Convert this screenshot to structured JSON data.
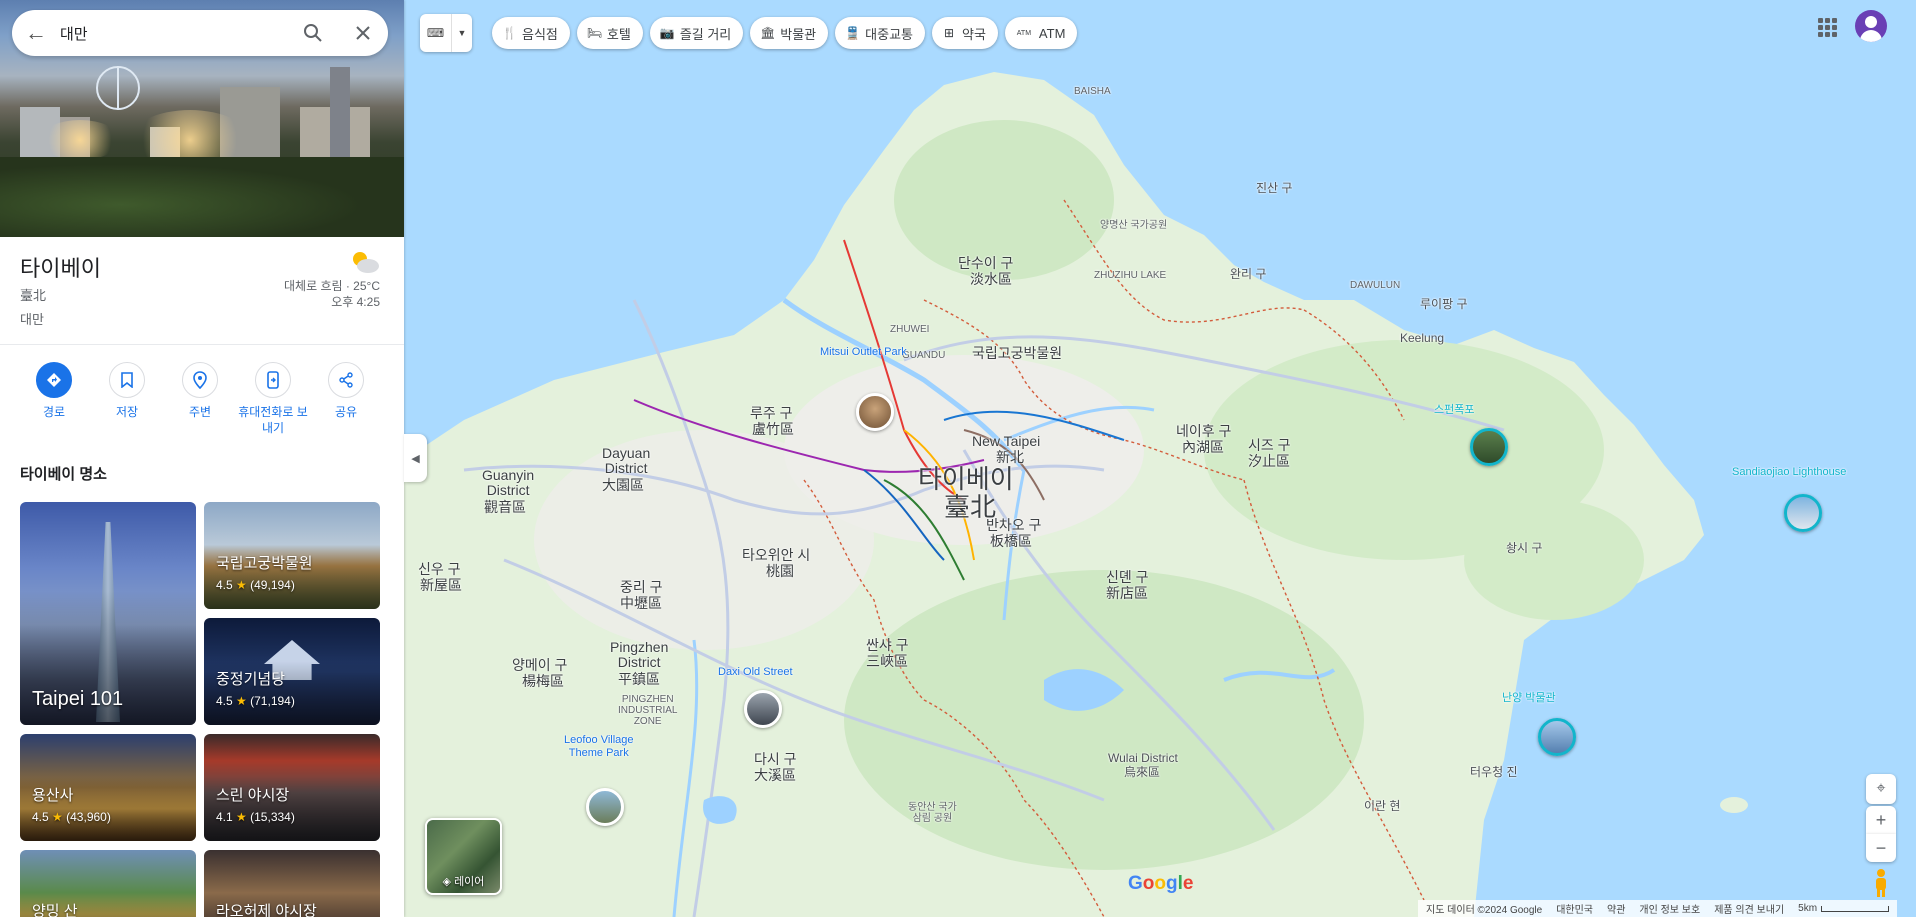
{
  "search": {
    "query": "대만"
  },
  "place": {
    "title": "타이베이",
    "native_name": "臺北",
    "country": "대만",
    "weather": "대체로 흐림 · 25°C",
    "time": "오후 4:25"
  },
  "actions": [
    {
      "label": "경로",
      "icon": "directions-icon"
    },
    {
      "label": "저장",
      "icon": "bookmark-icon"
    },
    {
      "label": "주변",
      "icon": "nearby-icon"
    },
    {
      "label": "휴대전화로 보\n내기",
      "icon": "send-to-phone-icon"
    },
    {
      "label": "공유",
      "icon": "share-icon"
    }
  ],
  "attractions": {
    "title": "타이베이 명소",
    "items": [
      {
        "name": "Taipei 101",
        "rating": "",
        "reviews": ""
      },
      {
        "name": "국립고궁박물원",
        "rating": "4.5",
        "reviews": "(49,194)"
      },
      {
        "name": "중정기념당",
        "rating": "4.5",
        "reviews": "(71,194)"
      },
      {
        "name": "용산사",
        "rating": "4.5",
        "reviews": "(43,960)"
      },
      {
        "name": "스린 야시장",
        "rating": "4.1",
        "reviews": "(15,334)"
      },
      {
        "name": "양밍 산",
        "rating": "",
        "reviews": ""
      },
      {
        "name": "라오허제 야시장",
        "rating": "",
        "reviews": ""
      }
    ]
  },
  "chips": [
    {
      "label": "음식점",
      "icon": "restaurant-icon"
    },
    {
      "label": "호텔",
      "icon": "hotel-icon"
    },
    {
      "label": "즐길 거리",
      "icon": "camera-icon"
    },
    {
      "label": "박물관",
      "icon": "museum-icon"
    },
    {
      "label": "대중교통",
      "icon": "transit-icon"
    },
    {
      "label": "약국",
      "icon": "pharmacy-icon"
    },
    {
      "label": "ATM",
      "icon": "atm-icon"
    }
  ],
  "map": {
    "labels": {
      "taipei": "타이베이",
      "taipei_cn": "臺北",
      "new_taipei": "New Taipei",
      "new_taipei_cn": "新北",
      "tamsui": "단수이 구",
      "tamsui_cn": "淡水區",
      "luzhu": "루주 구",
      "luzhu_cn": "盧竹區",
      "dayuan": "Dayuan\nDistrict",
      "dayuan_cn": "大園區",
      "guanyin": "Guanyin\nDistrict",
      "guanyin_cn": "觀音區",
      "xinwu": "신우 구",
      "xinwu_cn": "新屋區",
      "zhongli": "중리 구",
      "zhongli_cn": "中壢區",
      "taoyuan": "타오위안 시",
      "taoyuan_cn": "桃園",
      "pingzhen": "Pingzhen\nDistrict",
      "pingzhen_cn": "平鎮區",
      "yangmei": "양메이 구",
      "yangmei_cn": "楊梅區",
      "daxi": "다시 구",
      "daxi_cn": "大溪區",
      "sanxia": "싼샤 구",
      "sanxia_cn": "三峽區",
      "banqiao": "반차오 구",
      "banqiao_cn": "板橋區",
      "xindian": "신뎬 구",
      "xindian_cn": "新店區",
      "neihu": "네이후 구",
      "neihu_cn": "內湖區",
      "xizhi": "시즈 구",
      "xizhi_cn": "汐止區",
      "keelung": "Keelung",
      "wulai": "Wulai District",
      "wulai_cn": "烏來區",
      "npm": "국립고궁박물원",
      "mitsui": "Mitsui Outlet Park",
      "daxi_old": "Daxi Old Street",
      "leofoo": "Leofoo Village\nTheme Park",
      "sandiao": "Sandiaojiao Lighthouse",
      "shifen": "스펀폭포",
      "lanyang": "난양 박물관",
      "jinshan": "진산 구",
      "wanli": "완리 구",
      "ruifang": "루이팡 구",
      "shuangxi": "솽시 구",
      "toucheng": "터우청 진",
      "yilan": "이란 현",
      "zhuwei": "ZHUWEI",
      "guandu": "GUANDU",
      "zhuzihu": "ZHUZIHU LAKE",
      "baisha": "BAISHA",
      "dawulun": "DAWULUN",
      "yangmingshan": "양명산 국가공원",
      "pingzhen_ind": "PINGZHEN\nINDUSTRIAL\nZONE",
      "dongyan": "동안산 국가\n삼림 공원"
    }
  },
  "layers_label": "레이어",
  "google_logo": "Google",
  "footer": {
    "items": [
      "지도 데이터 ©2024 Google",
      "대한민국",
      "약관",
      "개인 정보 보호",
      "제품 의견 보내기"
    ],
    "scale": "5km"
  },
  "colors": {
    "accent": "#1a73e8",
    "land": "#e7f4e0",
    "water": "#aadaff",
    "urban": "#eeeeee",
    "border": "#d35c3b"
  }
}
